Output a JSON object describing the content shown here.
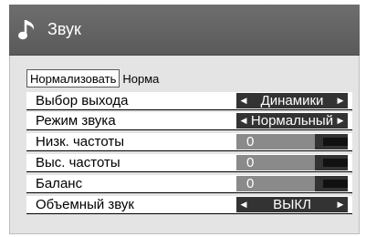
{
  "header": {
    "title": "Звук",
    "icon": "music-note-icon"
  },
  "normalize": {
    "button_label": "Нормализовать",
    "status": "Норма"
  },
  "settings": [
    {
      "label": "Выбор выхода",
      "type": "select",
      "value": "Динамики"
    },
    {
      "label": "Режим звука",
      "type": "select",
      "value": "Нормальный"
    },
    {
      "label": "Низк. частоты",
      "type": "slider",
      "value": "0"
    },
    {
      "label": "Выс. частоты",
      "type": "slider",
      "value": "0"
    },
    {
      "label": "Баланс",
      "type": "slider",
      "value": "0"
    },
    {
      "label": "Объемный звук",
      "type": "select",
      "value": "ВЫКЛ"
    }
  ],
  "colors": {
    "title_bar": "#5f5f5f",
    "panel": "#e4e4e4",
    "control": "#333333",
    "slider_value": "#8a8a8a"
  }
}
